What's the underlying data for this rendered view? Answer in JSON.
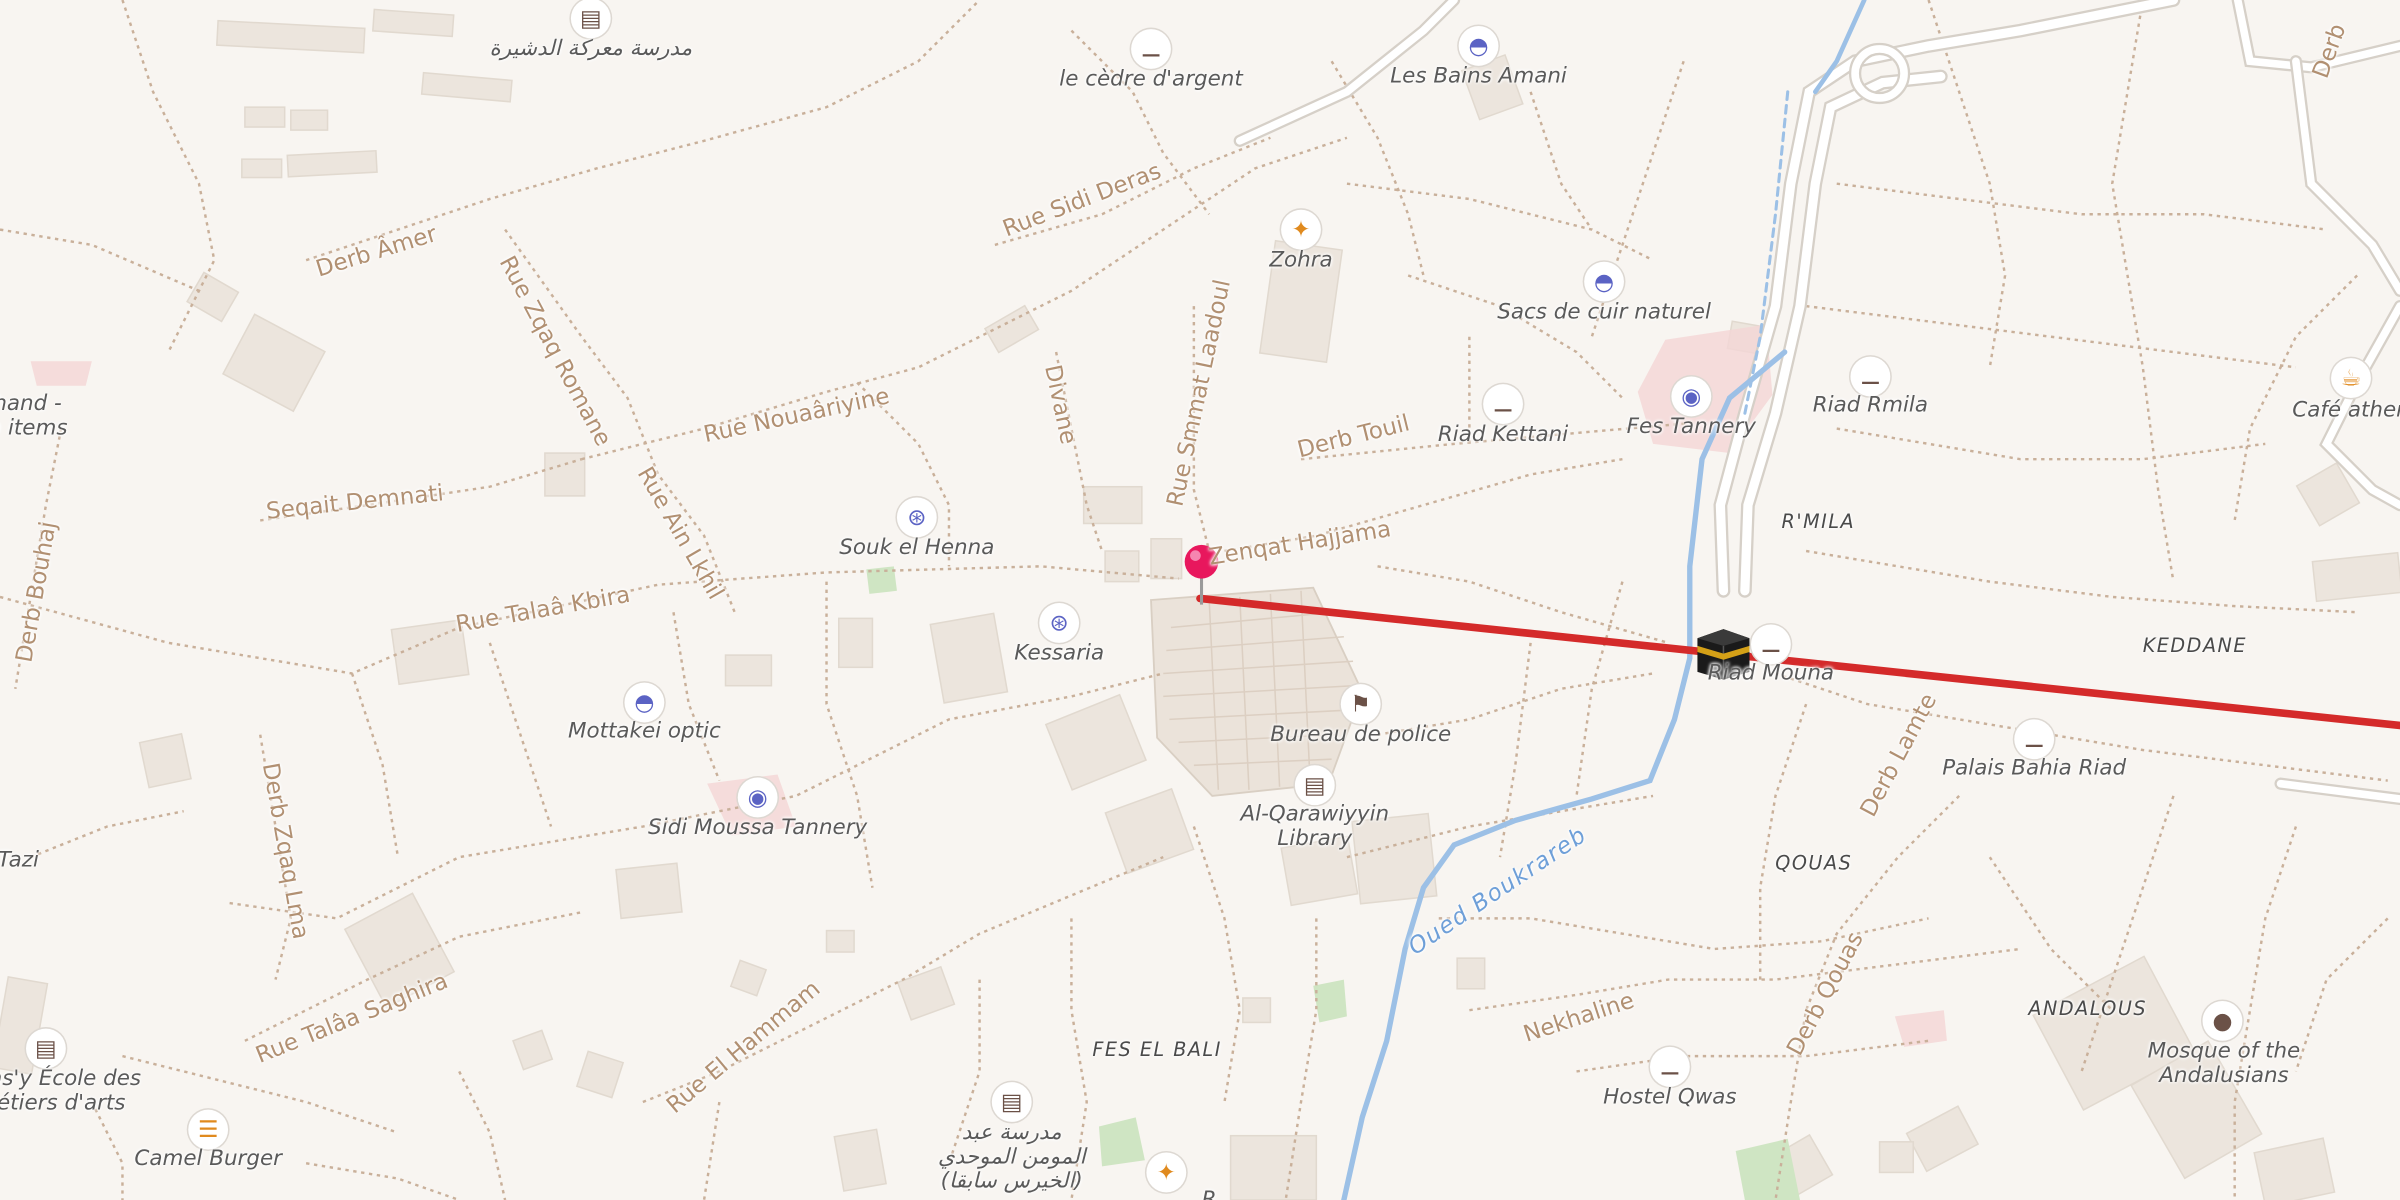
{
  "map": {
    "streets": [
      {
        "id": "rue-sidi-deras",
        "name": "Rue Sidi Deras"
      },
      {
        "id": "derb-amer",
        "name": "Derb Âmer"
      },
      {
        "id": "rue-zqaq-romane",
        "name": "Rue Zqaq Romane"
      },
      {
        "id": "rue-nouaariyine",
        "name": "Rue Nouaâriyine"
      },
      {
        "id": "divane",
        "name": "Divane"
      },
      {
        "id": "rue-smmat-laadoul",
        "name": "Rue Smmat Laadoul"
      },
      {
        "id": "derb-touil",
        "name": "Derb Touil"
      },
      {
        "id": "seqait-demnati",
        "name": "Seqait Demnati"
      },
      {
        "id": "rue-ain-lkhil",
        "name": "Rue Ain Lkhil"
      },
      {
        "id": "zenqat-hajjama",
        "name": "Zenqat Hajjama"
      },
      {
        "id": "rue-talaa-kbira",
        "name": "Rue Talaâ Kbira"
      },
      {
        "id": "derb-bouhaj",
        "name": "Derb Bouhaj"
      },
      {
        "id": "derb-zqaq-lma",
        "name": "Derb Zqaq Lma"
      },
      {
        "id": "rue-talaa-saghira",
        "name": "Rue Talâa Saghira"
      },
      {
        "id": "rue-el-hammam",
        "name": "Rue El Hammam"
      },
      {
        "id": "derb-lamte",
        "name": "Derb Lamte"
      },
      {
        "id": "nekhaline",
        "name": "Nekhaline"
      },
      {
        "id": "derb-qouas",
        "name": "Derb Qouas"
      },
      {
        "id": "derb-edge",
        "name": "Derb"
      }
    ],
    "water": [
      {
        "id": "oued-boukrareb",
        "name": "Oued Boukrareb"
      }
    ],
    "districts": [
      {
        "id": "rmila",
        "name": "R'MILA"
      },
      {
        "id": "keddane",
        "name": "KEDDANE"
      },
      {
        "id": "qouas",
        "name": "QOUAS"
      },
      {
        "id": "andalous",
        "name": "ANDALOUS"
      },
      {
        "id": "fes-el-bali",
        "name": "FES EL BALI"
      }
    ],
    "pois": [
      {
        "id": "madrasa-top",
        "label": "مدرسة معركة الدشيرة",
        "icon": "school-icon"
      },
      {
        "id": "le-cedre",
        "label": "le cèdre d'argent",
        "icon": "lodging-icon"
      },
      {
        "id": "bains-amani",
        "label": "Les Bains Amani",
        "icon": "shop-bag-icon"
      },
      {
        "id": "zohra",
        "label": "Zohra",
        "icon": "restaurant-icon"
      },
      {
        "id": "sacs-cuir",
        "label": "Sacs de cuir naturel",
        "icon": "shop-bag-icon"
      },
      {
        "id": "riad-rmila",
        "label": "Riad Rmila",
        "icon": "lodging-icon"
      },
      {
        "id": "cafe-athen",
        "label": "Café athen",
        "icon": "cafe-icon"
      },
      {
        "id": "riad-kettani",
        "label": "Riad Kettani",
        "icon": "lodging-icon"
      },
      {
        "id": "fes-tannery",
        "label": "Fes Tannery",
        "icon": "camera-icon"
      },
      {
        "id": "souk-henna",
        "label": "Souk el Henna",
        "icon": "cart-icon"
      },
      {
        "id": "kessaria",
        "label": "Kessaria",
        "icon": "cart-icon"
      },
      {
        "id": "riad-mouna",
        "label": "Riad Mouna",
        "icon": "lodging-icon"
      },
      {
        "id": "bureau-police",
        "label": "Bureau de police",
        "icon": "police-icon"
      },
      {
        "id": "qarawiyyin-library",
        "label": "Al-Qarawiyyin\nLibrary",
        "icon": "library-icon"
      },
      {
        "id": "mottakei-optic",
        "label": "Mottakei optic",
        "icon": "shop-bag-icon"
      },
      {
        "id": "sidi-moussa",
        "label": "Sidi Moussa Tannery",
        "icon": "camera-icon"
      },
      {
        "id": "palais-bahia",
        "label": "Palais Bahia Riad",
        "icon": "lodging-icon"
      },
      {
        "id": "ecole-arts",
        "label": "ms'y École des\nétiers d'arts",
        "icon": "school-icon"
      },
      {
        "id": "camel-burger",
        "label": "Camel Burger",
        "icon": "burger-icon"
      },
      {
        "id": "hostel-qwas",
        "label": "Hostel Qwas",
        "icon": "lodging-icon"
      },
      {
        "id": "mosque-andalusians",
        "label": "Mosque of the\nAndalusians",
        "icon": "mosque-icon"
      },
      {
        "id": "madrasa-bottom",
        "label": "مدرسة عبد\nالمومن الموحدي\n(الخيرس سابقا)",
        "icon": "school-icon"
      },
      {
        "id": "poi-bottom",
        "label": "R",
        "icon": "restaurant-icon"
      },
      {
        "id": "hand-items",
        "label": "hand -\nn items",
        "icon": ""
      },
      {
        "id": "tazi",
        "label": "Tazi",
        "icon": ""
      }
    ],
    "colors": {
      "background": "#f8f5f1",
      "path": "#c9b09a",
      "route": "#d42a2a",
      "river": "#9cc0e6",
      "pin": "#e8175d"
    }
  }
}
